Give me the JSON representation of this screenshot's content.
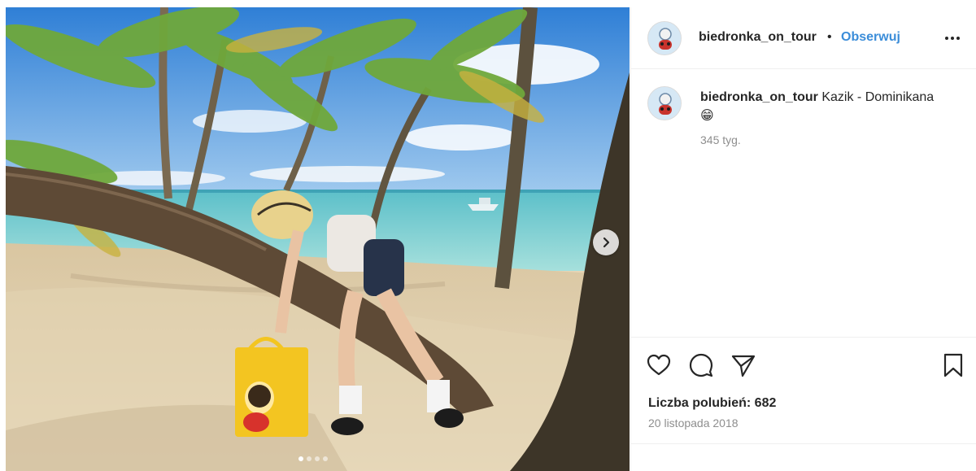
{
  "post": {
    "media": {
      "description_icon": "beach-photo",
      "carousel": {
        "total": 4,
        "active": 1
      },
      "next_icon": "chevron-right-icon"
    },
    "header": {
      "username": "biedronka_on_tour",
      "separator": "•",
      "follow_label": "Obserwuj",
      "more_icon": "more-horizontal-icon"
    },
    "caption": {
      "username": "biedronka_on_tour",
      "text": "Kazik - Dominikana 😁",
      "time": "345 tyg."
    },
    "actions": {
      "like_icon": "heart-icon",
      "comment_icon": "comment-icon",
      "share_icon": "share-icon",
      "save_icon": "bookmark-icon"
    },
    "likes_label": "Liczba polubień: 682",
    "date": "20 listopada 2018"
  },
  "colors": {
    "accent": "#3b8dd9",
    "text": "#262626",
    "muted": "#8e8e8e",
    "border": "#efefef"
  }
}
